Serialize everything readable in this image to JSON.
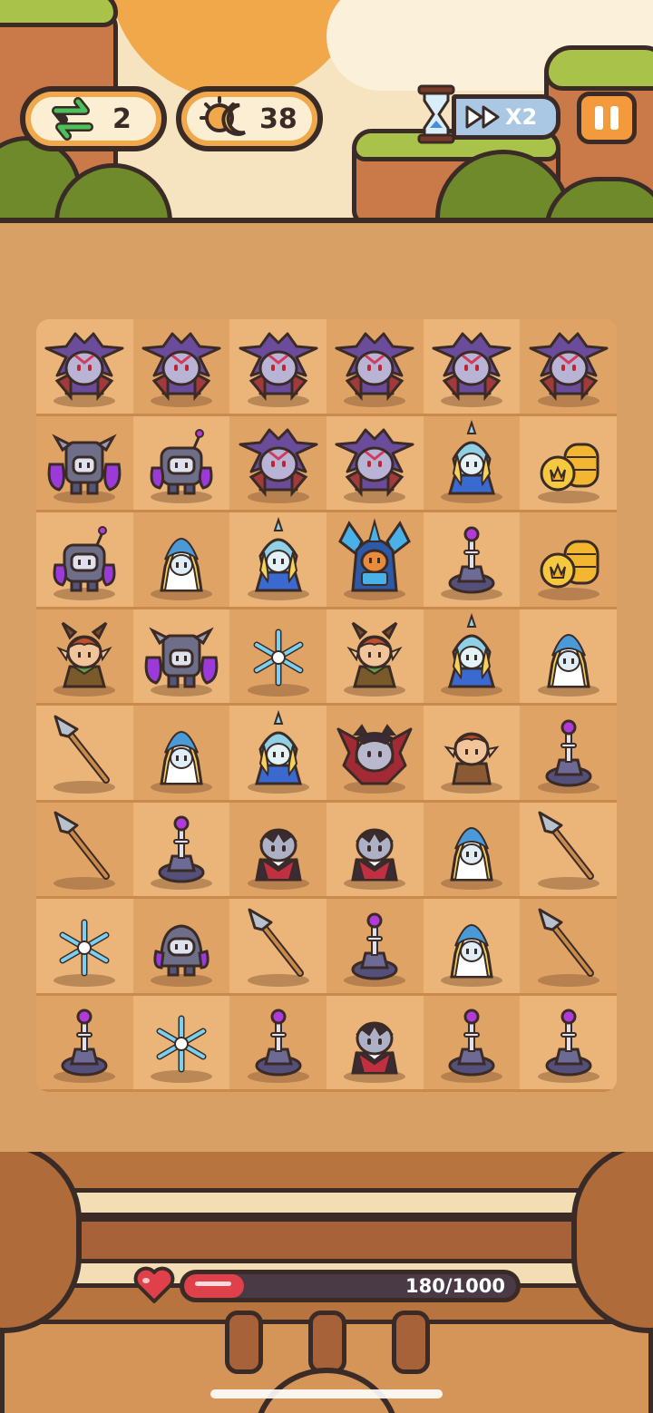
{
  "hud": {
    "swap_count": "2",
    "energy_count": "38",
    "speed_label": "X2"
  },
  "icons": {
    "swap": "swap-arrows-icon",
    "energy": "sun-moon-icon",
    "timer": "hourglass-icon",
    "fast_forward": "fast-forward-icon",
    "pause": "pause-icon",
    "health": "heart-icon"
  },
  "colors": {
    "accent": "#f0a84a",
    "health": "#e0404a",
    "speed_banner": "#aac8e4"
  },
  "board": {
    "columns": 6,
    "rows": [
      [
        "dark-dragon-lord",
        "dark-dragon-lord",
        "dark-dragon-lord",
        "dark-dragon-lord",
        "dark-dragon-lord",
        "dark-dragon-lord"
      ],
      [
        "purple-golem",
        "purple-robot",
        "dark-dragon-lord",
        "dark-dragon-lord",
        "ice-mage",
        "gold-coins"
      ],
      [
        "purple-robot",
        "hooded-cleric",
        "ice-mage",
        "ice-knight",
        "purple-tesla-tower",
        "gold-coins"
      ],
      [
        "horned-elf",
        "purple-golem",
        "snowflake",
        "horned-elf",
        "ice-mage",
        "hooded-cleric"
      ],
      [
        "spear",
        "hooded-cleric",
        "ice-mage",
        "vampire-lord",
        "elf-boy",
        "purple-tesla-tower"
      ],
      [
        "spear",
        "purple-tesla-tower",
        "vampire",
        "vampire",
        "hooded-cleric",
        "spear"
      ],
      [
        "snowflake",
        "purple-blob",
        "spear",
        "purple-tesla-tower",
        "hooded-cleric",
        "spear"
      ],
      [
        "purple-tesla-tower",
        "snowflake",
        "purple-tesla-tower",
        "vampire",
        "purple-tesla-tower",
        "purple-tesla-tower"
      ]
    ]
  },
  "health": {
    "text": "180/1000",
    "current": 180,
    "max": 1000
  }
}
